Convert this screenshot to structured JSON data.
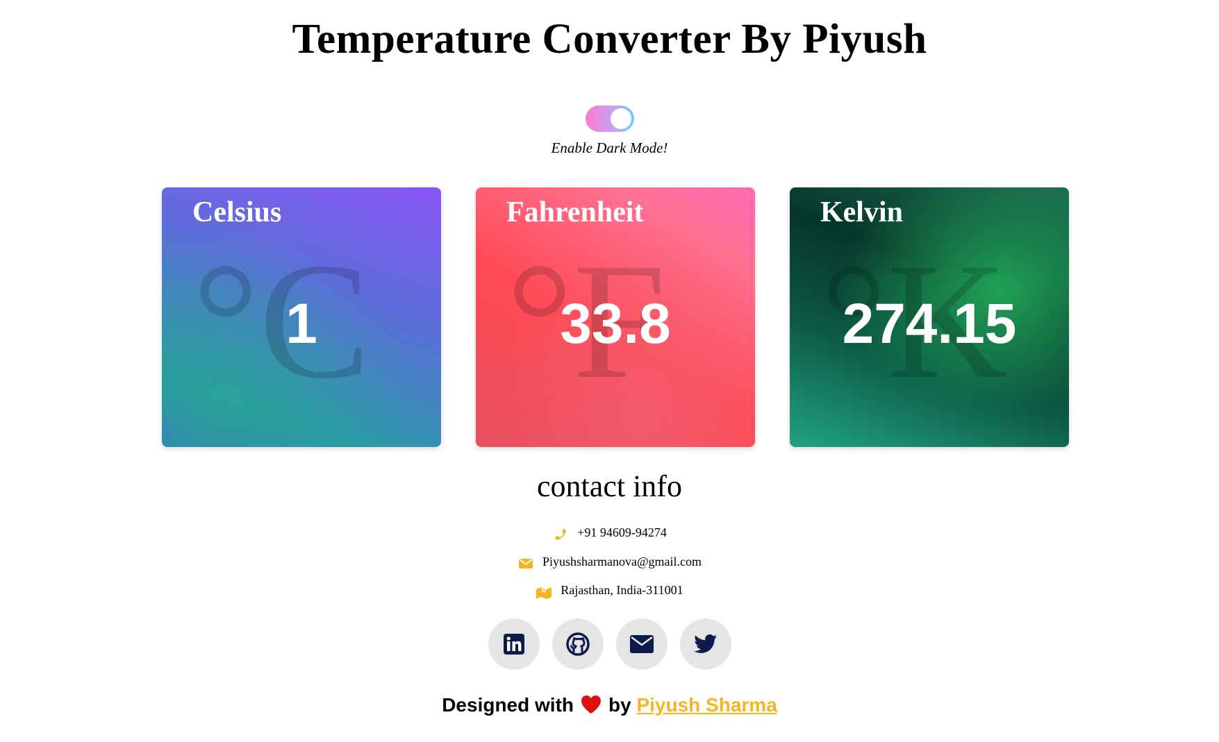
{
  "page": {
    "title": "Temperature Converter By Piyush"
  },
  "dark_mode_toggle": {
    "label": "Enable Dark Mode!",
    "state": "off"
  },
  "cards": {
    "celsius": {
      "name": "Celsius",
      "symbol": "°C",
      "value": "1"
    },
    "fahrenheit": {
      "name": "Fahrenheit",
      "symbol": "°F",
      "value": "33.8"
    },
    "kelvin": {
      "name": "Kelvin",
      "symbol": "°K",
      "value": "274.15"
    }
  },
  "contact": {
    "title": "contact info",
    "phone": "+91 94609-94274",
    "email": "Piyushsharmanova@gmail.com",
    "address": "Rajasthan, India-311001"
  },
  "socials": [
    "linkedin-icon",
    "github-icon",
    "envelope-icon",
    "twitter-icon"
  ],
  "footer": {
    "prefix": "Designed with",
    "middle": "by",
    "author": "Piyush Sharma"
  },
  "colors": {
    "accent": "#f5b51f",
    "icon_dark": "#0d1b4c",
    "heart": "#e01010"
  }
}
